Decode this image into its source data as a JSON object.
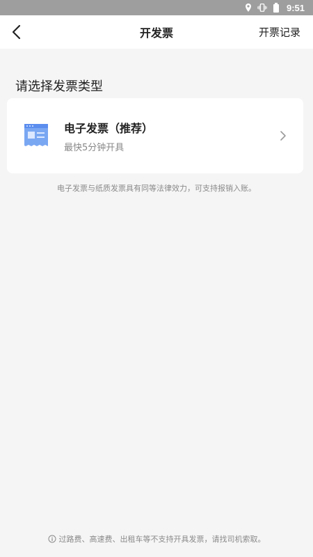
{
  "status": {
    "time": "9:51"
  },
  "nav": {
    "title": "开发票",
    "action": "开票记录"
  },
  "section": {
    "title": "请选择发票类型"
  },
  "card": {
    "title": "电子发票（推荐）",
    "subtitle": "最快5分钟开具",
    "accent": "#5b8def"
  },
  "note": "电子发票与纸质发票具有同等法律效力，可支持报销入账。",
  "footer": {
    "text": "过路费、高速费、出租车等不支持开具发票，请找司机索取。"
  },
  "icons": {
    "back": "chevron-left-icon",
    "chevron": "chevron-right-icon",
    "invoice": "invoice-icon",
    "info": "info-icon",
    "location": "location-icon",
    "vibrate": "vibrate-icon",
    "battery": "battery-icon"
  }
}
